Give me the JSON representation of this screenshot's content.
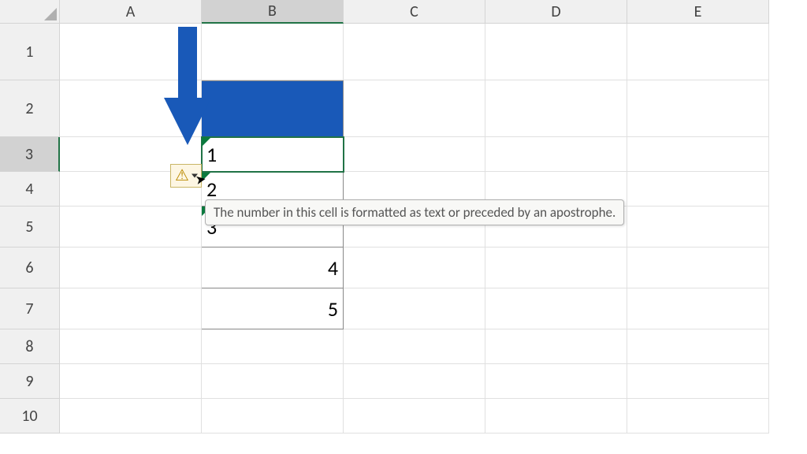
{
  "columns": [
    "A",
    "B",
    "C",
    "D",
    "E"
  ],
  "rows": [
    "1",
    "2",
    "3",
    "4",
    "5",
    "6",
    "7",
    "8",
    "9",
    "10"
  ],
  "selected_column": "B",
  "selected_row": "3",
  "cells": {
    "B2": {
      "fill": "blue"
    },
    "B3": {
      "value": "1",
      "align": "left",
      "text_format": true,
      "selected": true
    },
    "B4": {
      "value": "2",
      "align": "left",
      "text_format": true
    },
    "B5": {
      "value": "3",
      "align": "left",
      "text_format": true
    },
    "B6": {
      "value": "4",
      "align": "right"
    },
    "B7": {
      "value": "5",
      "align": "right"
    }
  },
  "tooltip_text": "The number in this cell is formatted as text or preceded by an apostrophe.",
  "arrow_color": "#1959b8"
}
